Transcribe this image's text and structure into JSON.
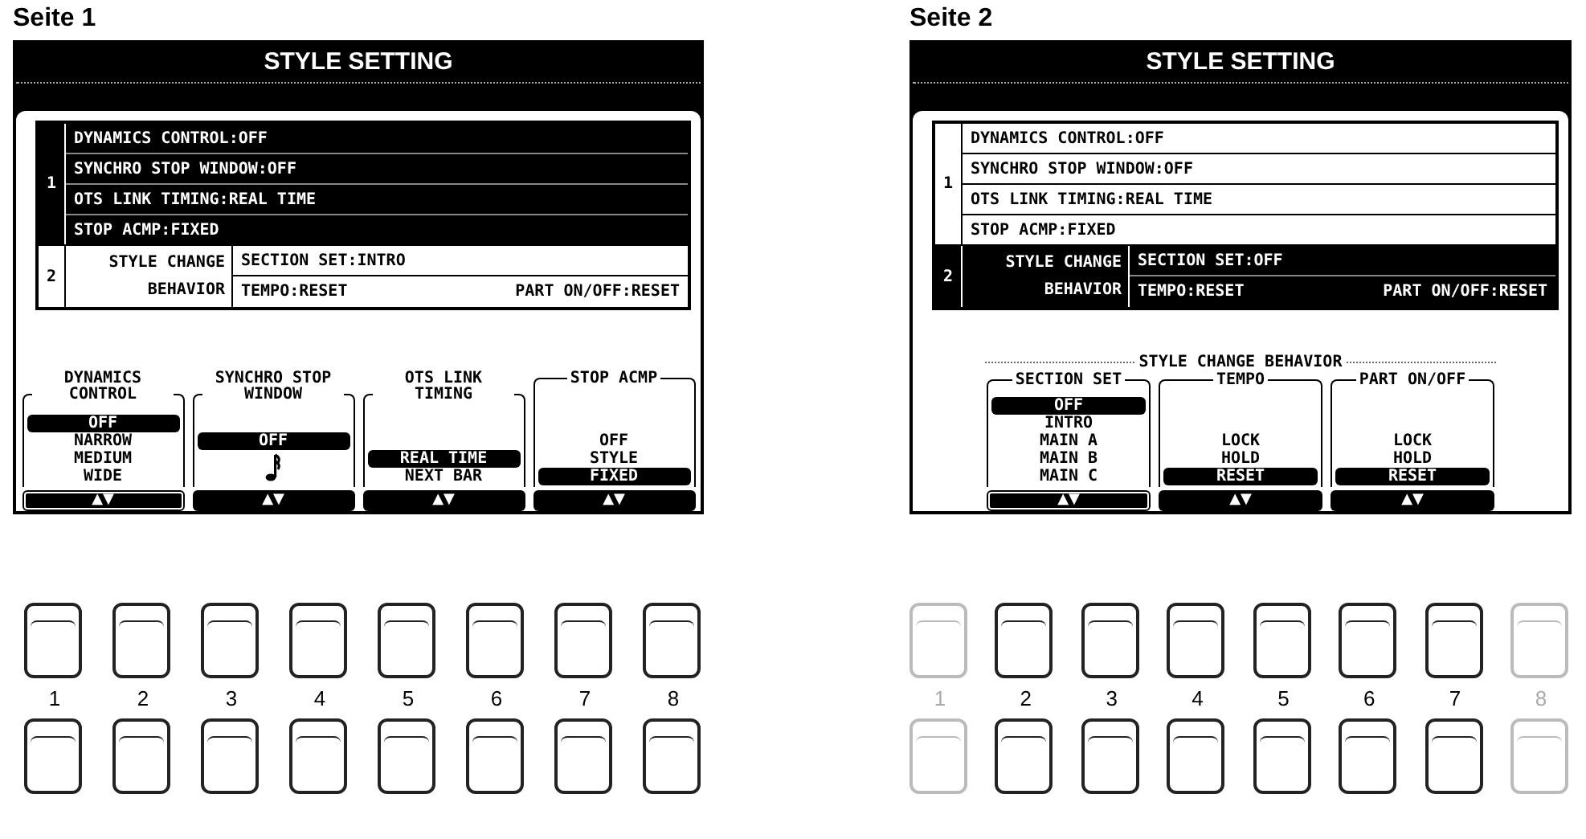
{
  "pages": [
    {
      "heading": "Seite 1",
      "screen": {
        "title": "STYLE SETTING",
        "groups": [
          {
            "number": "1",
            "selected": true,
            "rows": [
              [
                "DYNAMICS CONTROL:OFF"
              ],
              [
                "SYNCHRO STOP WINDOW:OFF"
              ],
              [
                "OTS LINK TIMING:REAL TIME"
              ],
              [
                "STOP ACMP:FIXED"
              ]
            ]
          },
          {
            "number": "2",
            "label": "STYLE CHANGE BEHAVIOR",
            "selected": false,
            "rows": [
              [
                "SECTION SET:INTRO"
              ],
              [
                "TEMPO:RESET",
                "PART ON/OFF:RESET"
              ]
            ]
          }
        ],
        "columns": [
          {
            "title": "DYNAMICS CONTROL",
            "options": [
              {
                "kind": "text",
                "label": "OFF",
                "selected": true
              },
              {
                "kind": "text",
                "label": "NARROW",
                "selected": false
              },
              {
                "kind": "text",
                "label": "MEDIUM",
                "selected": false
              },
              {
                "kind": "text",
                "label": "WIDE",
                "selected": false
              }
            ],
            "button": {
              "label": "▲▼",
              "selected": true
            }
          },
          {
            "title": "SYNCHRO STOP WINDOW",
            "options": [
              {
                "kind": "text",
                "label": "OFF",
                "selected": true
              },
              {
                "kind": "note",
                "selected": false
              }
            ],
            "button": {
              "label": "▲▼",
              "selected": false
            }
          },
          {
            "title": "OTS LINK TIMING",
            "options": [
              {
                "kind": "text",
                "label": "REAL TIME",
                "selected": true
              },
              {
                "kind": "text",
                "label": "NEXT BAR",
                "selected": false
              }
            ],
            "button": {
              "label": "▲▼",
              "selected": false
            }
          },
          {
            "title": "STOP ACMP",
            "options": [
              {
                "kind": "text",
                "label": "OFF",
                "selected": false
              },
              {
                "kind": "text",
                "label": "STYLE",
                "selected": false
              },
              {
                "kind": "text",
                "label": "FIXED",
                "selected": true
              }
            ],
            "button": {
              "label": "▲▼",
              "selected": false
            }
          }
        ]
      },
      "buttons": [
        {
          "label": "1",
          "disabled": false
        },
        {
          "label": "2",
          "disabled": false
        },
        {
          "label": "3",
          "disabled": false
        },
        {
          "label": "4",
          "disabled": false
        },
        {
          "label": "5",
          "disabled": false
        },
        {
          "label": "6",
          "disabled": false
        },
        {
          "label": "7",
          "disabled": false
        },
        {
          "label": "8",
          "disabled": false
        }
      ]
    },
    {
      "heading": "Seite 2",
      "screen": {
        "title": "STYLE SETTING",
        "groups": [
          {
            "number": "1",
            "selected": false,
            "rows": [
              [
                "DYNAMICS CONTROL:OFF"
              ],
              [
                "SYNCHRO STOP WINDOW:OFF"
              ],
              [
                "OTS LINK TIMING:REAL TIME"
              ],
              [
                "STOP ACMP:FIXED"
              ]
            ]
          },
          {
            "number": "2",
            "label": "STYLE CHANGE BEHAVIOR",
            "selected": true,
            "rows": [
              [
                "SECTION SET:OFF"
              ],
              [
                "TEMPO:RESET",
                "PART ON/OFF:RESET"
              ]
            ]
          }
        ],
        "group_title": "STYLE CHANGE BEHAVIOR",
        "columns": [
          {
            "title": "SECTION SET",
            "options": [
              {
                "kind": "text",
                "label": "OFF",
                "selected": true
              },
              {
                "kind": "text",
                "label": "INTRO",
                "selected": false
              },
              {
                "kind": "text",
                "label": "MAIN A",
                "selected": false
              },
              {
                "kind": "text",
                "label": "MAIN B",
                "selected": false
              },
              {
                "kind": "text",
                "label": "MAIN C",
                "selected": false
              }
            ],
            "button": {
              "label": "▲▼",
              "selected": true
            }
          },
          {
            "title": "TEMPO",
            "options": [
              {
                "kind": "text",
                "label": "LOCK",
                "selected": false
              },
              {
                "kind": "text",
                "label": "HOLD",
                "selected": false
              },
              {
                "kind": "text",
                "label": "RESET",
                "selected": true
              }
            ],
            "button": {
              "label": "▲▼",
              "selected": false
            }
          },
          {
            "title": "PART ON/OFF",
            "options": [
              {
                "kind": "text",
                "label": "LOCK",
                "selected": false
              },
              {
                "kind": "text",
                "label": "HOLD",
                "selected": false
              },
              {
                "kind": "text",
                "label": "RESET",
                "selected": true
              }
            ],
            "button": {
              "label": "▲▼",
              "selected": false
            }
          }
        ]
      },
      "buttons": [
        {
          "label": "1",
          "disabled": true
        },
        {
          "label": "2",
          "disabled": false
        },
        {
          "label": "3",
          "disabled": false
        },
        {
          "label": "4",
          "disabled": false
        },
        {
          "label": "5",
          "disabled": false
        },
        {
          "label": "6",
          "disabled": false
        },
        {
          "label": "7",
          "disabled": false
        },
        {
          "label": "8",
          "disabled": true
        }
      ]
    }
  ]
}
